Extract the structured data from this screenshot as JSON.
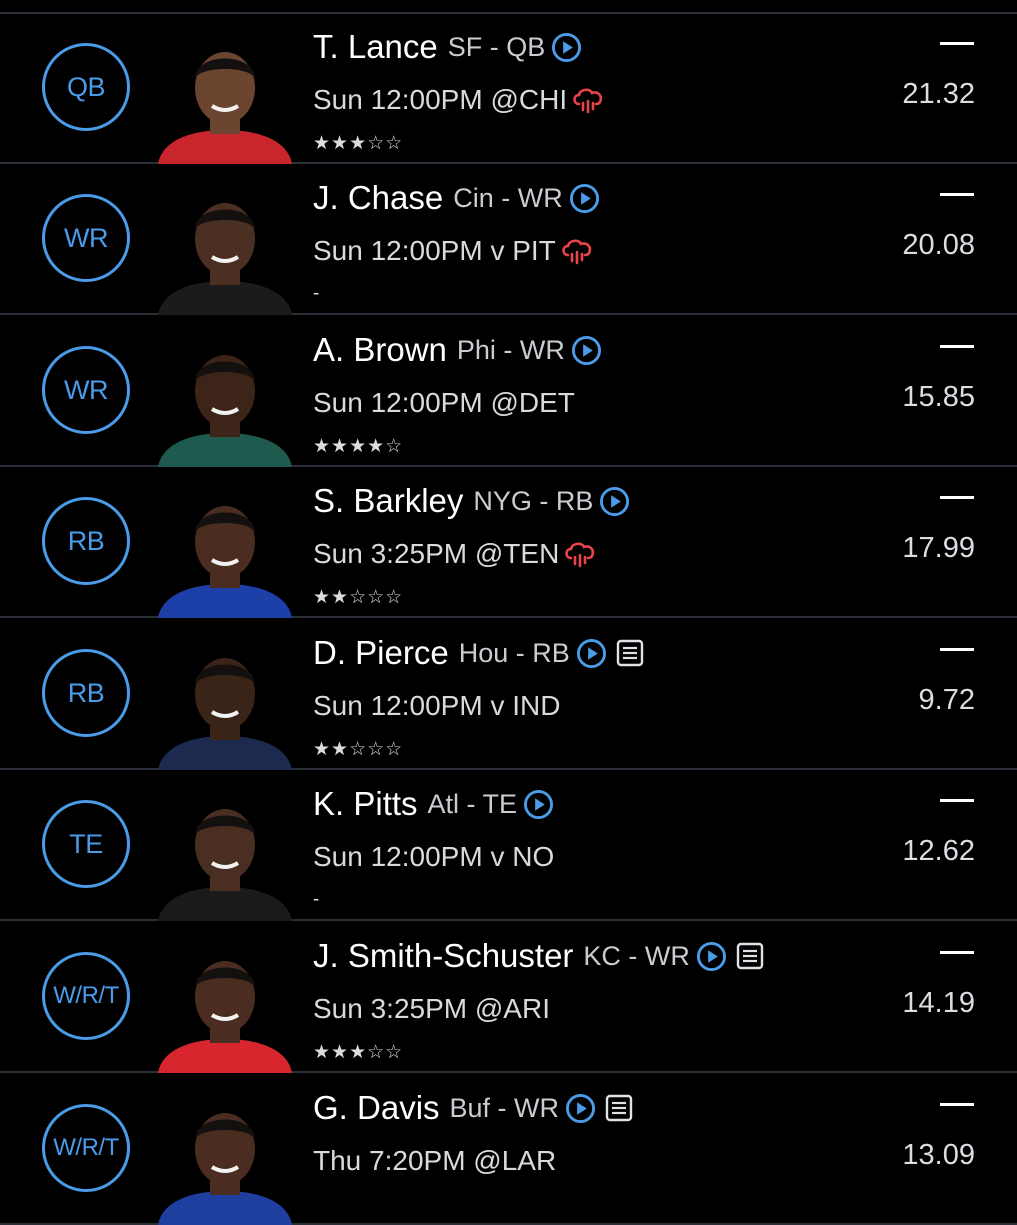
{
  "colors": {
    "accent": "#4a9be8",
    "weather_alert": "#e8444a",
    "background": "#000000"
  },
  "players": [
    {
      "position": "QB",
      "name": "T. Lance",
      "team_pos": "SF - QB",
      "game": "Sun 12:00PM @CHI",
      "weather": true,
      "news": false,
      "rating_text": "★★★☆☆",
      "rating": 3,
      "status": "—",
      "points": "21.32",
      "jersey": "#c9252c",
      "skin": "#6b4530"
    },
    {
      "position": "WR",
      "name": "J. Chase",
      "team_pos": "Cin - WR",
      "game": "Sun 12:00PM v PIT",
      "weather": true,
      "news": false,
      "rating_text": "-",
      "rating": null,
      "status": "—",
      "points": "20.08",
      "jersey": "#1b1b1b",
      "skin": "#4a2f22"
    },
    {
      "position": "WR",
      "name": "A. Brown",
      "team_pos": "Phi - WR",
      "game": "Sun 12:00PM @DET",
      "weather": false,
      "news": false,
      "rating_text": "★★★★☆",
      "rating": 4,
      "status": "—",
      "points": "15.85",
      "jersey": "#1f5a4f",
      "skin": "#3c2418"
    },
    {
      "position": "RB",
      "name": "S. Barkley",
      "team_pos": "NYG - RB",
      "game": "Sun 3:25PM @TEN",
      "weather": true,
      "news": false,
      "rating_text": "★★☆☆☆",
      "rating": 2,
      "status": "—",
      "points": "17.99",
      "jersey": "#1d3fa8",
      "skin": "#4a2c20"
    },
    {
      "position": "RB",
      "name": "D. Pierce",
      "team_pos": "Hou - RB",
      "game": "Sun 12:00PM v IND",
      "weather": false,
      "news": true,
      "rating_text": "★★☆☆☆",
      "rating": 2,
      "status": "—",
      "points": "9.72",
      "jersey": "#1b2a4e",
      "skin": "#3a2418"
    },
    {
      "position": "TE",
      "name": "K. Pitts",
      "team_pos": "Atl - TE",
      "game": "Sun 12:00PM v NO",
      "weather": false,
      "news": false,
      "rating_text": "-",
      "rating": null,
      "status": "—",
      "points": "12.62",
      "jersey": "#1a1a1a",
      "skin": "#4a2e22"
    },
    {
      "position": "W/R/T",
      "name": "J. Smith-Schuster",
      "team_pos": "KC - WR",
      "game": "Sun 3:25PM @ARI",
      "weather": false,
      "news": true,
      "rating_text": "★★★☆☆",
      "rating": 3,
      "status": "—",
      "points": "14.19",
      "jersey": "#d7262d",
      "skin": "#4a2c20"
    },
    {
      "position": "W/R/T",
      "name": "G. Davis",
      "team_pos": "Buf - WR",
      "game": "Thu 7:20PM @LAR",
      "weather": false,
      "news": true,
      "rating_text": "",
      "rating": null,
      "status": "—",
      "points": "13.09",
      "jersey": "#1e3fa0",
      "skin": "#4a2c20"
    }
  ]
}
